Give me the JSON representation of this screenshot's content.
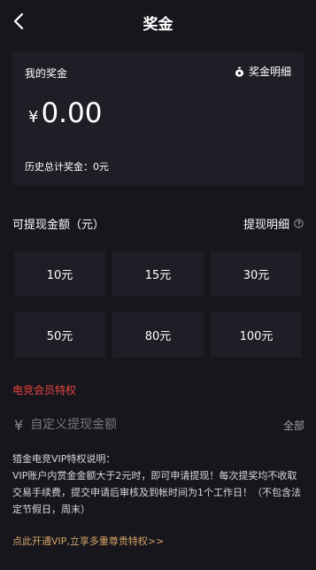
{
  "header": {
    "title": "奖金"
  },
  "balance_card": {
    "label": "我的奖金",
    "detail_link": "奖金明细",
    "currency_symbol": "¥",
    "amount": "0.00",
    "history_total": "历史总计奖金：0元"
  },
  "withdraw": {
    "label": "可提现金额（元）",
    "detail_link": "提现明细",
    "amounts": [
      "10元",
      "15元",
      "30元",
      "50元",
      "80元",
      "100元"
    ]
  },
  "vip": {
    "title": "电竞会员特权",
    "currency_symbol": "¥",
    "custom_placeholder": "自定义提现金额",
    "all_button": "全部",
    "description_title": "猎金电竞VIP特权说明：",
    "description_body": "VIP账户内赏金金额大于2元时，即可申请提现！每次提奖均不收取交易手续费，提交申请后审核及到帐时间为1个工作日！（不包含法定节假日，周末）",
    "cta": "点此开通VIP,立享多重尊贵特权>>"
  },
  "colors": {
    "background": "#17161d",
    "card": "#1f1e27",
    "vip_title": "#e5443f",
    "cta": "#d6a566"
  }
}
